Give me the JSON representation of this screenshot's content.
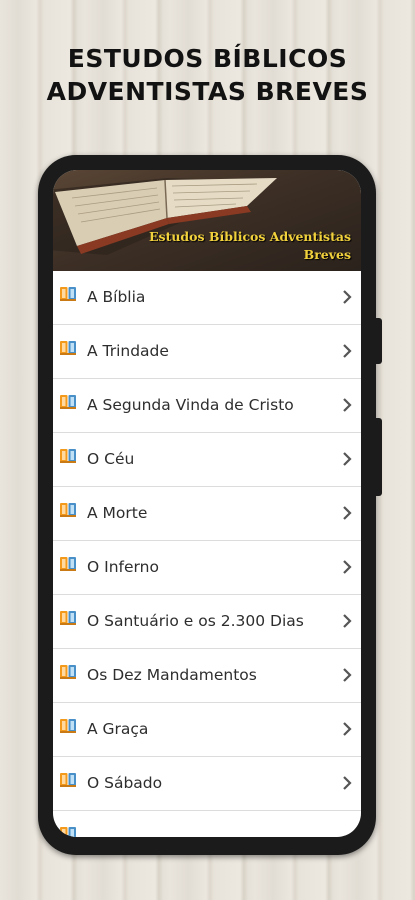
{
  "headline": {
    "line1": "ESTUDOS BÍBLICOS",
    "line2": "ADVENTISTAS BREVES"
  },
  "app": {
    "banner_title_line1": "Estudos Bíblicos Adventistas",
    "banner_title_line2": "Breves"
  },
  "list": {
    "item_icon": "bible-book-icon",
    "chevron_icon": "chevron-right-icon",
    "items": [
      {
        "label": "A Bíblia"
      },
      {
        "label": "A Trindade"
      },
      {
        "label": "A Segunda Vinda de Cristo"
      },
      {
        "label": "O Céu"
      },
      {
        "label": "A Morte"
      },
      {
        "label": "O Inferno"
      },
      {
        "label": "O Santuário e os 2.300 Dias"
      },
      {
        "label": "Os Dez Mandamentos"
      },
      {
        "label": "A Graça"
      },
      {
        "label": "O Sábado"
      }
    ]
  },
  "colors": {
    "banner_text": "#f2d23c",
    "icon_orange": "#f39a1c",
    "icon_blue": "#4a90c8",
    "chevron": "#555555"
  }
}
